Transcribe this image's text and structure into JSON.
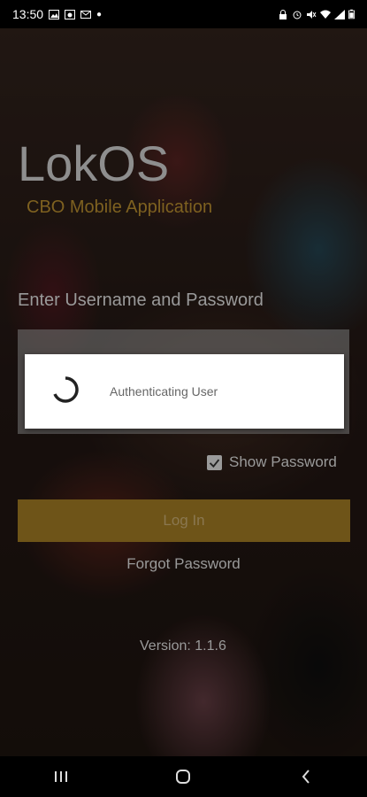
{
  "status_bar": {
    "time": "13:50",
    "left_icons": [
      "image-icon",
      "photo-icon",
      "mail-icon",
      "dot-icon"
    ],
    "right_icons": [
      "lock-icon",
      "alarm-icon",
      "mute-icon",
      "wifi-icon",
      "signal-icon",
      "battery-icon"
    ]
  },
  "app": {
    "brand": "LokOS",
    "subtitle": "CBO Mobile Application",
    "prompt": "Enter Username and Password"
  },
  "dialog": {
    "message": "Authenticating User"
  },
  "form": {
    "show_password_label": "Show Password",
    "show_password_checked": true,
    "login_label": "Log In",
    "forgot_label": "Forgot Password",
    "version": "Version: 1.1.6"
  },
  "nav_bar": {
    "icons": [
      "recents-icon",
      "home-icon",
      "back-icon"
    ]
  },
  "colors": {
    "accent": "#6e5418",
    "subtitle": "#7e6120"
  }
}
